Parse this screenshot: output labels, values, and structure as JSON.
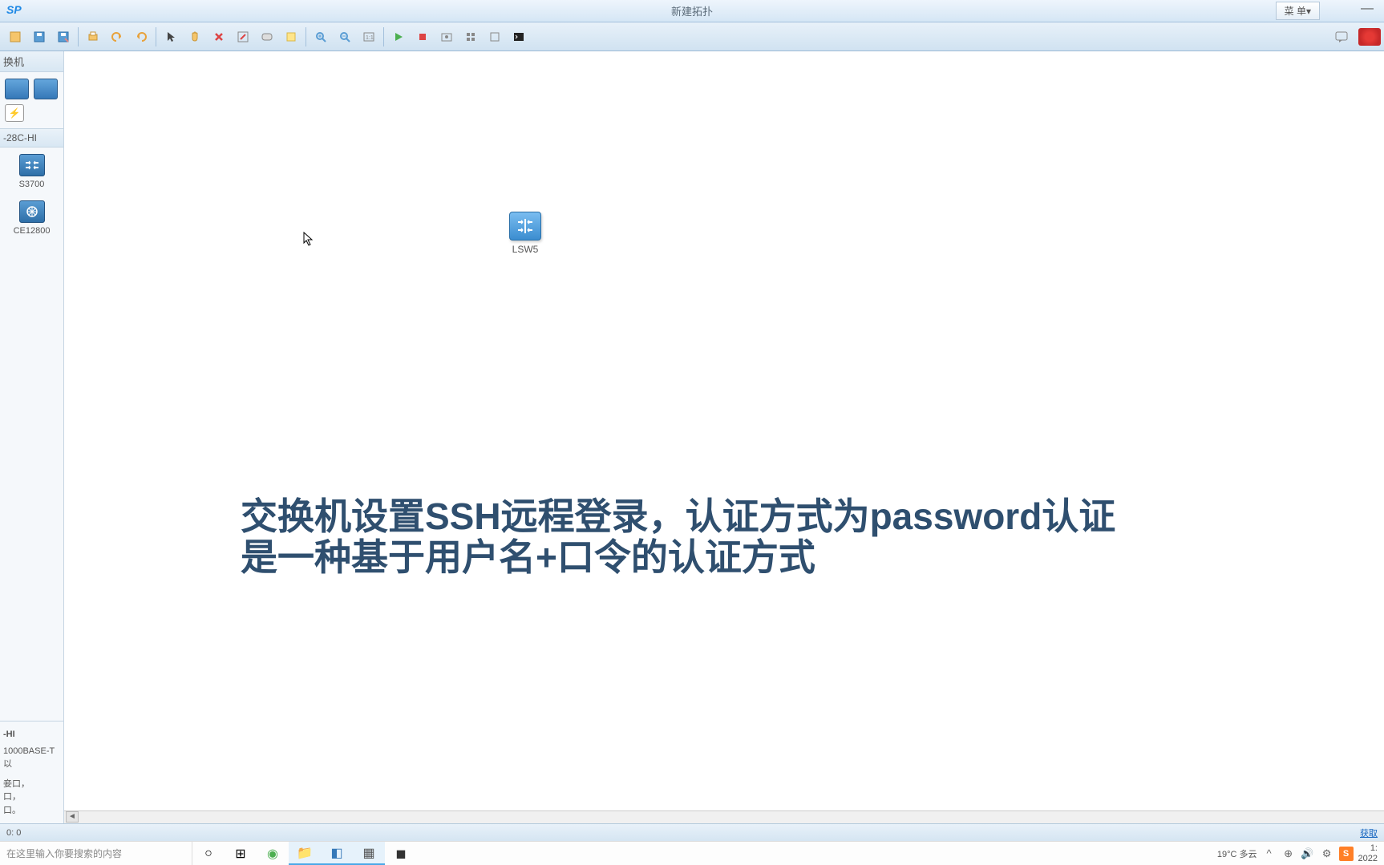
{
  "titlebar": {
    "app_logo": "SP",
    "title": "新建拓扑",
    "menu_label": "菜 单▾"
  },
  "toolbar": {
    "icons": [
      "new",
      "save",
      "saveas",
      "print",
      "undo",
      "redo",
      "pointer",
      "hand",
      "delete",
      "edit",
      "annotation",
      "note",
      "zoomin",
      "zoomout",
      "fit",
      "play",
      "stop",
      "capture",
      "expand",
      "window",
      "terminal"
    ]
  },
  "sidebar": {
    "header": "换机",
    "list_header": "-28C-HI",
    "devices": [
      {
        "label": "S3700"
      },
      {
        "label": "CE12800"
      }
    ],
    "desc_title": "-HI",
    "desc_line1": "1000BASE-T以",
    "desc_line2": "妾口，",
    "desc_line3": "口，",
    "desc_line4": "口。"
  },
  "canvas": {
    "node_label": "LSW5",
    "overlay_line1": "交换机设置SSH远程登录，认证方式为password认证",
    "overlay_line2": "是一种基于用户名+口令的认证方式"
  },
  "statusbar": {
    "left": "0:  0",
    "right": "获取"
  },
  "taskbar": {
    "search_placeholder": "在这里输入你要搜索的内容",
    "weather": "19°C 多云",
    "time": "1:",
    "date": "2022"
  }
}
